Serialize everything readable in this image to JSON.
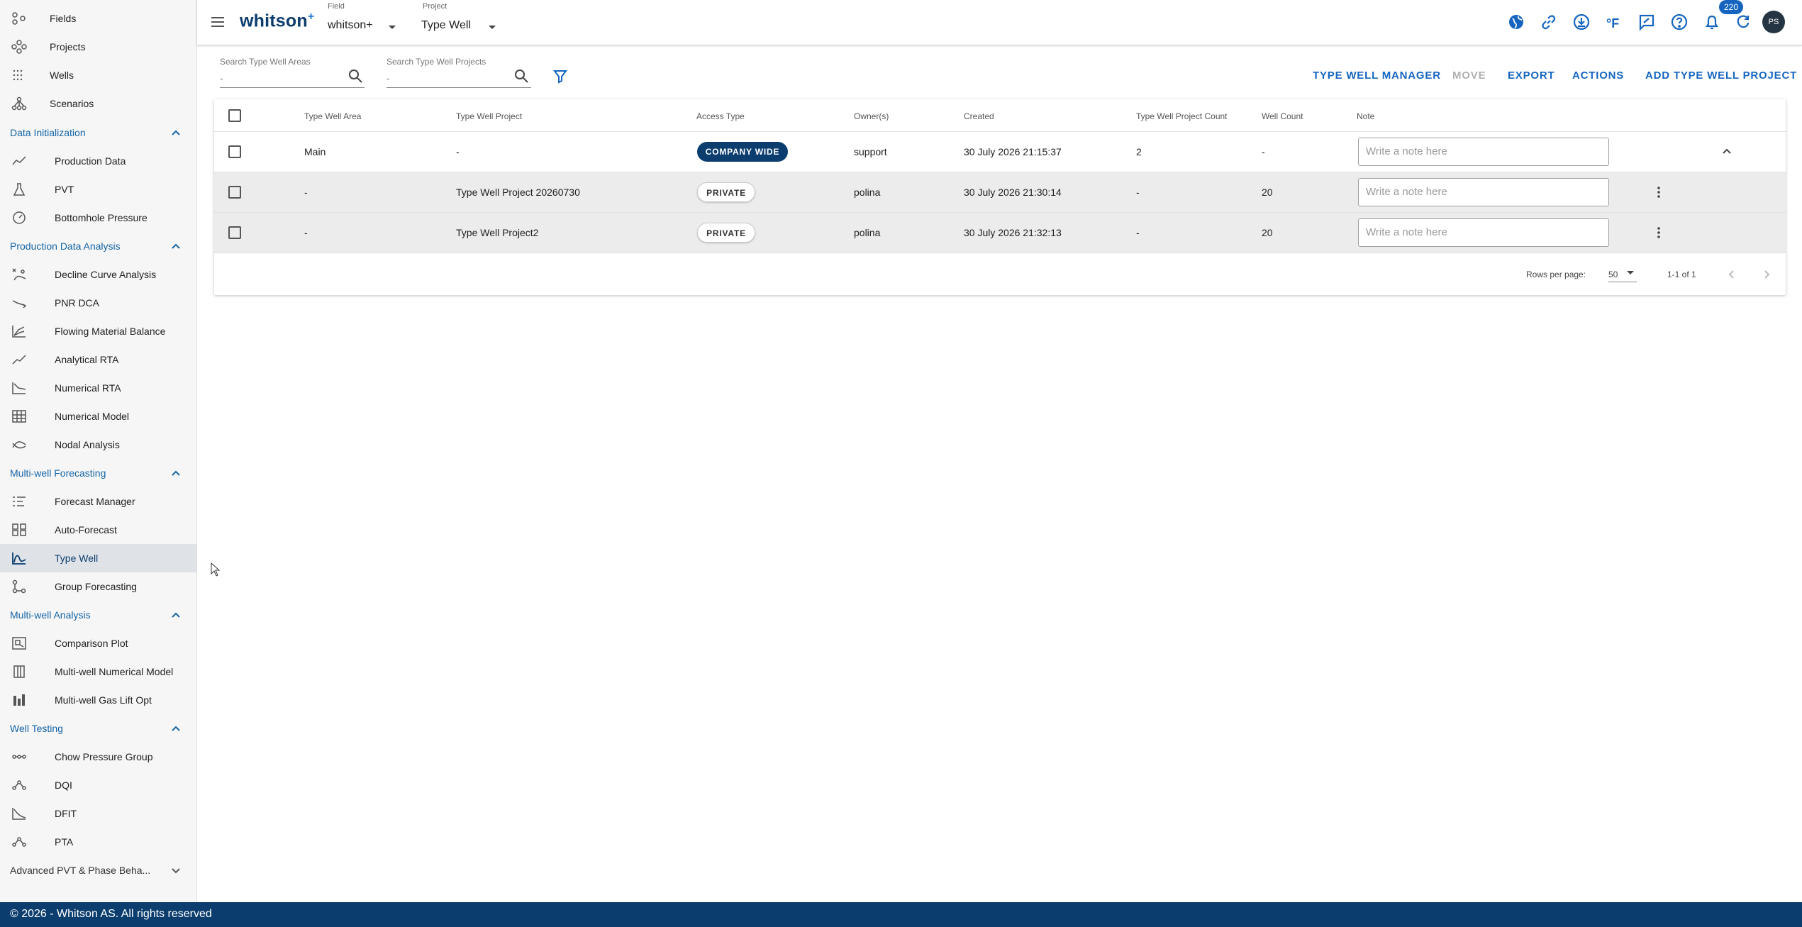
{
  "sidebar": {
    "top_items": [
      {
        "label": "Fields",
        "icon": "fields-icon"
      },
      {
        "label": "Projects",
        "icon": "projects-icon"
      },
      {
        "label": "Wells",
        "icon": "wells-icon"
      },
      {
        "label": "Scenarios",
        "icon": "scenarios-icon"
      }
    ],
    "sections": [
      {
        "title": "Data Initialization",
        "items": [
          "Production Data",
          "PVT",
          "Bottomhole Pressure"
        ]
      },
      {
        "title": "Production Data Analysis",
        "items": [
          "Decline Curve Analysis",
          "PNR DCA",
          "Flowing Material Balance",
          "Analytical RTA",
          "Numerical RTA",
          "Numerical Model",
          "Nodal Analysis"
        ]
      },
      {
        "title": "Multi-well Forecasting",
        "items": [
          "Forecast Manager",
          "Auto-Forecast",
          "Type Well",
          "Group Forecasting"
        ]
      },
      {
        "title": "Multi-well Analysis",
        "items": [
          "Comparison Plot",
          "Multi-well Numerical Model",
          "Multi-well Gas Lift Opt"
        ]
      },
      {
        "title": "Well Testing",
        "items": [
          "Chow Pressure Group",
          "DQI",
          "DFIT",
          "PTA"
        ]
      },
      {
        "title": "Advanced PVT & Phase Beha..."
      }
    ],
    "active_item": "Type Well"
  },
  "header": {
    "logo": "whitson",
    "logo_sup": "+",
    "field_label": "Field",
    "field_value": "whitson+",
    "project_label": "Project",
    "project_value": "Type Well",
    "icons": [
      "globe-icon",
      "link-icon",
      "download-icon",
      "fahrenheit-icon",
      "feedback-icon",
      "help-icon",
      "bell-icon",
      "refresh-icon"
    ],
    "notification_count": "220",
    "avatar_initials": "PS"
  },
  "toolbar": {
    "search_areas_label": "Search Type Well Areas",
    "search_areas_placeholder": "-",
    "search_projects_label": "Search Type Well Projects",
    "search_projects_placeholder": "-",
    "buttons": {
      "manager": "TYPE WELL MANAGER",
      "move": "MOVE",
      "export": "EXPORT",
      "actions": "ACTIONS",
      "add": "ADD TYPE WELL PROJECT"
    }
  },
  "table": {
    "columns": [
      "Type Well Area",
      "Type Well Project",
      "Access Type",
      "Owner(s)",
      "Created",
      "Type Well Project Count",
      "Well Count",
      "Note"
    ],
    "rows": [
      {
        "area": "Main",
        "project": "-",
        "access": "COMPANY WIDE",
        "owner": "support",
        "created": "30 July 2026 21:15:37",
        "project_count": "2",
        "well_count": "-",
        "note_placeholder": "Write a note here"
      },
      {
        "area": "-",
        "project": "Type Well Project 20260730",
        "access": "PRIVATE",
        "owner": "polina",
        "created": "30 July 2026 21:30:14",
        "project_count": "-",
        "well_count": "20",
        "note_placeholder": "Write a note here"
      },
      {
        "area": "-",
        "project": "Type Well Project2",
        "access": "PRIVATE",
        "owner": "polina",
        "created": "30 July 2026 21:32:13",
        "project_count": "-",
        "well_count": "20",
        "note_placeholder": "Write a note here"
      }
    ],
    "rows_per_page_label": "Rows per page:",
    "rows_per_page_value": "50",
    "range_text": "1-1 of 1"
  },
  "footer": {
    "copyright": "© 2026 - Whitson AS. All rights reserved"
  },
  "colors": {
    "brand_navy": "#0b3d6e",
    "accent_blue": "#1565c0",
    "sidebar_bg": "#f6f6f6"
  }
}
